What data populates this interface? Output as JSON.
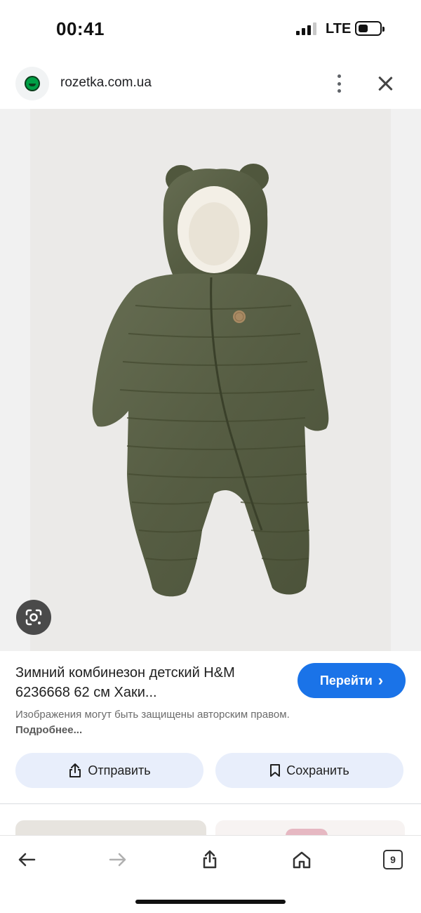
{
  "status_bar": {
    "time": "00:41",
    "network": "LTE",
    "signal_bars_filled": 3,
    "signal_bars_total": 4
  },
  "address_bar": {
    "site_icon": "rozetka-logo-icon",
    "domain": "rozetka.com.ua",
    "menu_icon": "more-vert-icon",
    "close_icon": "close-icon"
  },
  "image": {
    "lens_icon": "google-lens-icon"
  },
  "result": {
    "title": "Зимний комбинезон детский H&M 6236668 62 см Хаки...",
    "goto_label": "Перейти",
    "copyright_text": "Изображения могут быть защищены авторским правом.",
    "more_link": "Подробнее..."
  },
  "actions": {
    "share_label": "Отправить",
    "save_label": "Сохранить"
  },
  "toolbar": {
    "back_icon": "arrow-back-icon",
    "forward_icon": "arrow-forward-icon",
    "share_icon": "share-icon",
    "home_icon": "home-icon",
    "tabs_count": "9"
  },
  "colors": {
    "accent": "#1a73e8",
    "action_bg": "#e8eefb",
    "garment": "#5a6146"
  }
}
